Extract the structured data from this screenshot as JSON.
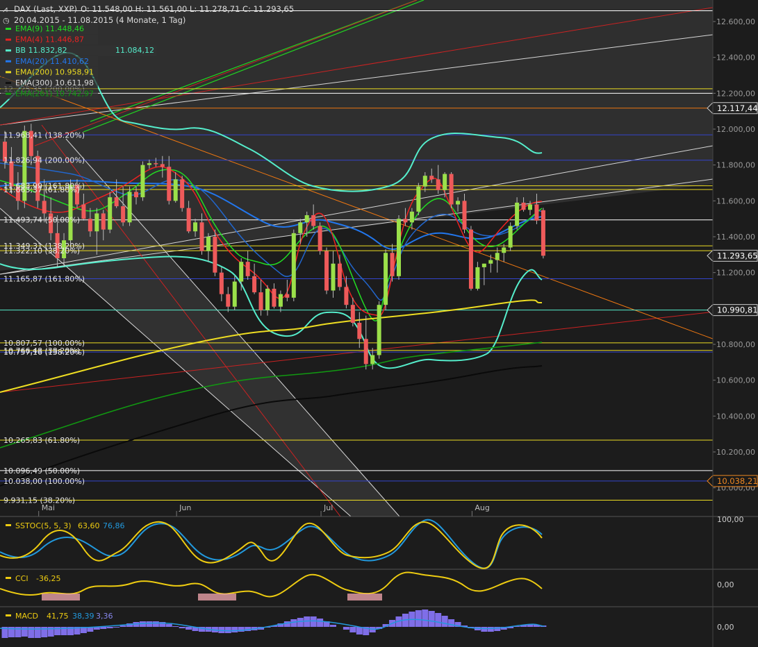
{
  "header": {
    "instrument": "DAX (Last, XXP)",
    "ohlc": "O: 11.548,00  H: 11.561,00  L: 11.278,71  C: 11.293,65",
    "range": "20.04.2015 - 11.08.2015 (4 Monate, 1 Tag)"
  },
  "legend": [
    {
      "label": "EMA(9)  11.448,46",
      "color": "#22dd22"
    },
    {
      "label": "EMA(4)  11.446,87",
      "color": "#ee2222"
    },
    {
      "label": "BB  11.832,82",
      "extra": "11.084,12",
      "color": "#55eecc"
    },
    {
      "label": "EMA(20)  11.410,62",
      "color": "#2277ee"
    },
    {
      "label": "EMA(200)  10.958,91",
      "color": "#eedd22"
    },
    {
      "label": "EMA(300)  10.611,98",
      "color": "#111111"
    },
    {
      "label": "EMA(261)  10.742,97",
      "color": "#119911"
    }
  ],
  "fib_labels": [
    {
      "text": "11.968,41 (138.20%)",
      "price": 11968
    },
    {
      "text": "11.826,94 (200.00%)",
      "price": 11827
    },
    {
      "text": "11.683,99 (161.80%)",
      "price": 11684
    },
    {
      "text": "11.663,37 (61.80%)",
      "price": 11663
    },
    {
      "text": "11.493,74 (50.00%)",
      "price": 11494
    },
    {
      "text": "11.349,31 (138.20%)",
      "price": 11349
    },
    {
      "text": "11.322,10 (38.20%)",
      "price": 11322
    },
    {
      "text": "11.165,87 (161.80%)",
      "price": 11166
    },
    {
      "text": "10.807,57 (100.00%)",
      "price": 10808
    },
    {
      "text": "10.766,48 (38.20%)",
      "price": 10766
    },
    {
      "text": "10.757,16 (138.20%)",
      "price": 10757
    },
    {
      "text": "10.265,83 (61.80%)",
      "price": 10266
    },
    {
      "text": "10.096,49 (50.00%)",
      "price": 10096
    },
    {
      "text": "10.038,00 (100.00%)",
      "price": 10038
    },
    {
      "text": "9.931,15 (38.20%)",
      "price": 9931
    },
    {
      "text": "12.225,35 (200.00%)",
      "price": 12225
    }
  ],
  "price_badges": [
    {
      "text": "12.117,44",
      "price": 12117,
      "style": "dark"
    },
    {
      "text": "11.293,65",
      "price": 11294,
      "style": "dark"
    },
    {
      "text": "10.990,81",
      "price": 10991,
      "style": "dark"
    },
    {
      "text": "10.038,21",
      "price": 10038,
      "style": "orange"
    }
  ],
  "indicators": {
    "sstoc": {
      "label": "SSTOC(5, 5, 3)",
      "v1": "63,60",
      "v2": "76,86",
      "axis": "100,00"
    },
    "cci": {
      "label": "CCI",
      "v1": "-36,25",
      "axis": "0,00"
    },
    "macd": {
      "label": "MACD",
      "v1": "41,75",
      "v2": "38,39",
      "v3": "3,36",
      "axis": "0,00"
    }
  },
  "chart_data": {
    "type": "candlestick",
    "title": "DAX (Last, XXP)",
    "x_labels": [
      {
        "label": "Mai",
        "index": 6
      },
      {
        "label": "Jun",
        "index": 27
      },
      {
        "label": "Jul",
        "index": 49
      },
      {
        "label": "Aug",
        "index": 72
      }
    ],
    "y_ticks": [
      "12.600,00",
      "12.400,00",
      "12.200,00",
      "12.000,00",
      "11.800,00",
      "11.600,00",
      "11.400,00",
      "11.200,00",
      "11.000,00",
      "10.800,00",
      "10.600,00",
      "10.400,00",
      "10.200,00",
      "10.000,00"
    ],
    "ylim": [
      9840,
      12720
    ],
    "candles": [
      [
        11930,
        11990,
        11780,
        11820
      ],
      [
        11820,
        11900,
        11640,
        11680
      ],
      [
        11680,
        11760,
        11550,
        11600
      ],
      [
        11600,
        12020,
        11560,
        11990
      ],
      [
        11990,
        12030,
        11800,
        11850
      ],
      [
        11850,
        11880,
        11560,
        11600
      ],
      [
        11600,
        11720,
        11480,
        11530
      ],
      [
        11530,
        11620,
        11380,
        11420
      ],
      [
        11420,
        11520,
        11230,
        11280
      ],
      [
        11280,
        11420,
        11230,
        11380
      ],
      [
        11380,
        11720,
        11360,
        11690
      ],
      [
        11690,
        11720,
        11560,
        11580
      ],
      [
        11580,
        11640,
        11490,
        11500
      ],
      [
        11500,
        11560,
        11400,
        11430
      ],
      [
        11430,
        11560,
        11300,
        11530
      ],
      [
        11530,
        11550,
        11380,
        11440
      ],
      [
        11440,
        11650,
        11420,
        11620
      ],
      [
        11620,
        11720,
        11560,
        11570
      ],
      [
        11570,
        11680,
        11460,
        11480
      ],
      [
        11480,
        11680,
        11460,
        11650
      ],
      [
        11650,
        11680,
        11580,
        11620
      ],
      [
        11620,
        11820,
        11600,
        11800
      ],
      [
        11800,
        11830,
        11780,
        11810
      ],
      [
        11810,
        11840,
        11790,
        11805
      ],
      [
        11805,
        11850,
        11730,
        11790
      ],
      [
        11790,
        11850,
        11580,
        11600
      ],
      [
        11600,
        11760,
        11590,
        11720
      ],
      [
        11720,
        11740,
        11540,
        11560
      ],
      [
        11560,
        11600,
        11420,
        11430
      ],
      [
        11430,
        11500,
        11400,
        11480
      ],
      [
        11480,
        11530,
        11300,
        11320
      ],
      [
        11320,
        11420,
        11260,
        11400
      ],
      [
        11400,
        11440,
        11180,
        11200
      ],
      [
        11200,
        11230,
        11040,
        11080
      ],
      [
        11080,
        11120,
        10980,
        11010
      ],
      [
        11010,
        11180,
        10990,
        11150
      ],
      [
        11150,
        11280,
        11100,
        11260
      ],
      [
        11260,
        11320,
        11160,
        11180
      ],
      [
        11180,
        11250,
        11080,
        11090
      ],
      [
        11090,
        11160,
        10960,
        10990
      ],
      [
        10990,
        11130,
        10960,
        11110
      ],
      [
        11110,
        11140,
        11000,
        11010
      ],
      [
        11010,
        11100,
        10980,
        11080
      ],
      [
        11080,
        11160,
        11040,
        11060
      ],
      [
        11060,
        11440,
        11040,
        11420
      ],
      [
        11420,
        11500,
        11360,
        11480
      ],
      [
        11480,
        11540,
        11400,
        11520
      ],
      [
        11520,
        11580,
        11440,
        11460
      ],
      [
        11460,
        11480,
        11300,
        11320
      ],
      [
        11320,
        11340,
        11080,
        11100
      ],
      [
        11100,
        11320,
        11060,
        11250
      ],
      [
        11250,
        11300,
        11100,
        11120
      ],
      [
        11120,
        11180,
        11000,
        11020
      ],
      [
        11020,
        11060,
        10900,
        10920
      ],
      [
        10920,
        10980,
        10780,
        10830
      ],
      [
        10830,
        10960,
        10660,
        10690
      ],
      [
        10690,
        10780,
        10660,
        10740
      ],
      [
        10740,
        11040,
        10720,
        11020
      ],
      [
        11020,
        11330,
        10990,
        11310
      ],
      [
        11310,
        11360,
        11150,
        11180
      ],
      [
        11180,
        11520,
        11160,
        11500
      ],
      [
        11500,
        11560,
        11460,
        11480
      ],
      [
        11480,
        11560,
        11440,
        11540
      ],
      [
        11540,
        11700,
        11520,
        11680
      ],
      [
        11680,
        11760,
        11650,
        11740
      ],
      [
        11740,
        11780,
        11700,
        11720
      ],
      [
        11720,
        11800,
        11640,
        11660
      ],
      [
        11660,
        11760,
        11620,
        11750
      ],
      [
        11750,
        11760,
        11560,
        11580
      ],
      [
        11580,
        11620,
        11540,
        11600
      ],
      [
        11600,
        11640,
        11420,
        11440
      ],
      [
        11440,
        11460,
        11100,
        11110
      ],
      [
        11110,
        11260,
        11100,
        11230
      ],
      [
        11230,
        11250,
        11130,
        11250
      ],
      [
        11250,
        11300,
        11200,
        11270
      ],
      [
        11270,
        11340,
        11200,
        11310
      ],
      [
        11310,
        11360,
        11260,
        11340
      ],
      [
        11340,
        11480,
        11320,
        11460
      ],
      [
        11460,
        11620,
        11440,
        11590
      ],
      [
        11590,
        11620,
        11540,
        11550
      ],
      [
        11550,
        11600,
        11520,
        11580
      ],
      [
        11580,
        11640,
        11470,
        11490
      ],
      [
        11548,
        11561,
        11279,
        11294
      ]
    ]
  }
}
